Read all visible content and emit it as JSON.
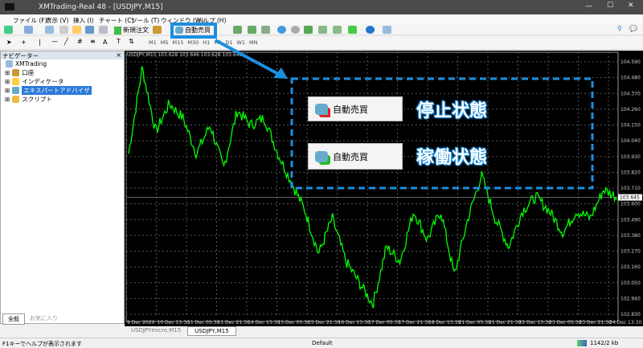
{
  "window": {
    "title": "XMTrading-Real 48 - [USDJPY,M15]"
  },
  "menu": [
    "ファイル (F)",
    "表示 (V)",
    "挿入 (I)",
    "チャート (C)",
    "ツール (T)",
    "ウィンドウ (W)",
    "ヘルプ (H)"
  ],
  "toolbar": {
    "new_order": "新規注文",
    "auto_trade": "自動売買",
    "timeframes": [
      "M1",
      "M5",
      "M15",
      "M30",
      "H1",
      "H4",
      "D1",
      "W1",
      "MN"
    ]
  },
  "navigator": {
    "title": "ナビゲーター",
    "root": "XMTrading",
    "items": [
      "口座",
      "インディケータ",
      "エキスパートアドバイザ",
      "スクリプト"
    ],
    "tabs": [
      "全般",
      "お気に入り"
    ]
  },
  "chart": {
    "header": "USDJPY,M15  103.628 103.646 103.628 103.645",
    "current_price": "103.645",
    "price_labels": [
      "104.590",
      "104.480",
      "104.370",
      "104.260",
      "104.150",
      "104.040",
      "103.930",
      "103.820",
      "103.710",
      "103.600",
      "103.490",
      "103.380",
      "103.270",
      "103.160",
      "103.050",
      "102.940",
      "102.830"
    ],
    "time_labels": [
      "9 Dec 2020",
      "10 Dec 13:30",
      "11 Dec 05:30",
      "11 Dec 21:30",
      "14 Dec 13:30",
      "15 Dec 05:30",
      "15 Dec 21:30",
      "16 Dec 13:30",
      "17 Dec 05:30",
      "17 Dec 21:30",
      "18 Dec 13:30",
      "21 Dec 05:30",
      "21 Dec 21:30",
      "22 Dec 13:30",
      "23 Dec 05:30",
      "23 Dec 21:30",
      "24 Dec 13:30"
    ],
    "tabs": [
      "USDJPYmicro,M15",
      "USDJPY,M15"
    ],
    "prices": [
      103.95,
      104.55,
      104.1,
      104.3,
      104.2,
      103.95,
      104.15,
      103.85,
      104.25,
      104.15,
      104.2,
      103.95,
      103.75,
      103.55,
      103.25,
      103.5,
      103.2,
      103.05,
      102.9,
      103.3,
      103.2,
      103.55,
      103.35,
      103.55,
      103.1,
      103.5,
      103.8,
      103.5,
      103.3,
      103.55,
      103.65,
      103.55,
      103.4,
      103.55,
      103.5,
      103.7,
      103.645
    ]
  },
  "annotation": {
    "button_label": "自動売買",
    "stopped": "停止状態",
    "running": "稼働状態"
  },
  "status": {
    "help": "F1キーでヘルプが表示されます",
    "profile": "Default",
    "traffic": "1142/2 kb"
  }
}
